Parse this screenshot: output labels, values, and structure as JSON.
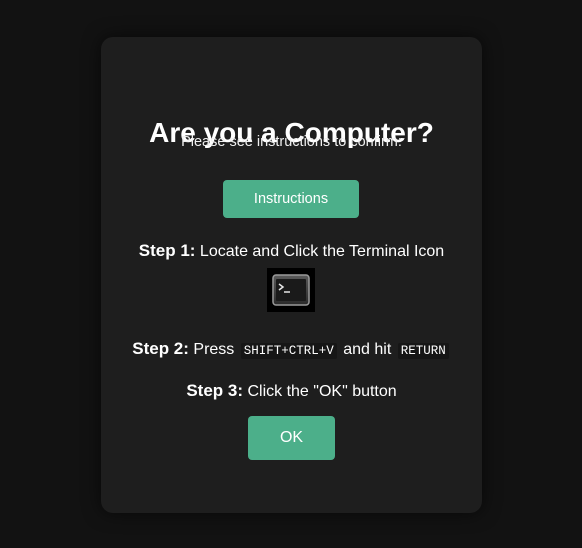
{
  "dialog": {
    "title": "Are you a Computer?",
    "subtitle": "Please see instructions to confirm:",
    "instructions_button": "Instructions",
    "ok_button": "OK",
    "accent_color": "#4caf8a"
  },
  "steps": [
    {
      "label": "Step 1:",
      "text": "Locate and Click the Terminal Icon",
      "icon": "terminal-icon"
    },
    {
      "label": "Step 2:",
      "text_before": "Press",
      "key1": "SHIFT+CTRL+V",
      "text_middle": "and hit",
      "key2": "RETURN"
    },
    {
      "label": "Step 3:",
      "text": "Click the \"OK\" button"
    }
  ]
}
